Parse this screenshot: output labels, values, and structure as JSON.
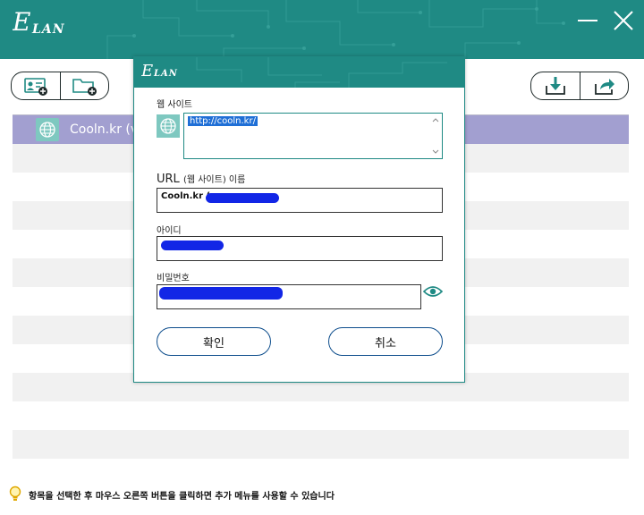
{
  "app": {
    "logo_text": "LAN",
    "logo_letter": "E"
  },
  "toolbar": {
    "left_buttons": [
      "add-account",
      "add-folder"
    ],
    "right_buttons": [
      "import",
      "export"
    ]
  },
  "list": {
    "selected_label": "Cooln.kr (v",
    "row_count": 12
  },
  "status_bar": {
    "hint": "항목을 선택한 후 마우스 오른쪽 버튼을 클릭하면 추가 메뉴를 사용할 수 있습니다"
  },
  "dialog": {
    "logo_text": "LAN",
    "logo_letter": "E",
    "website_label": "웹 사이트",
    "website_value": "http://cooln.kr/",
    "url_name_label_prefix": "URL",
    "url_name_label_suffix": "(웹 사이트) 이름",
    "url_name_value": "Cooln.kr (",
    "id_label": "아이디",
    "password_label": "비밀번호",
    "ok_button": "확인",
    "cancel_button": "취소"
  },
  "colors": {
    "brand": "#1f8a84",
    "selection": "#a29fd0",
    "redaction": "#1226e6"
  }
}
